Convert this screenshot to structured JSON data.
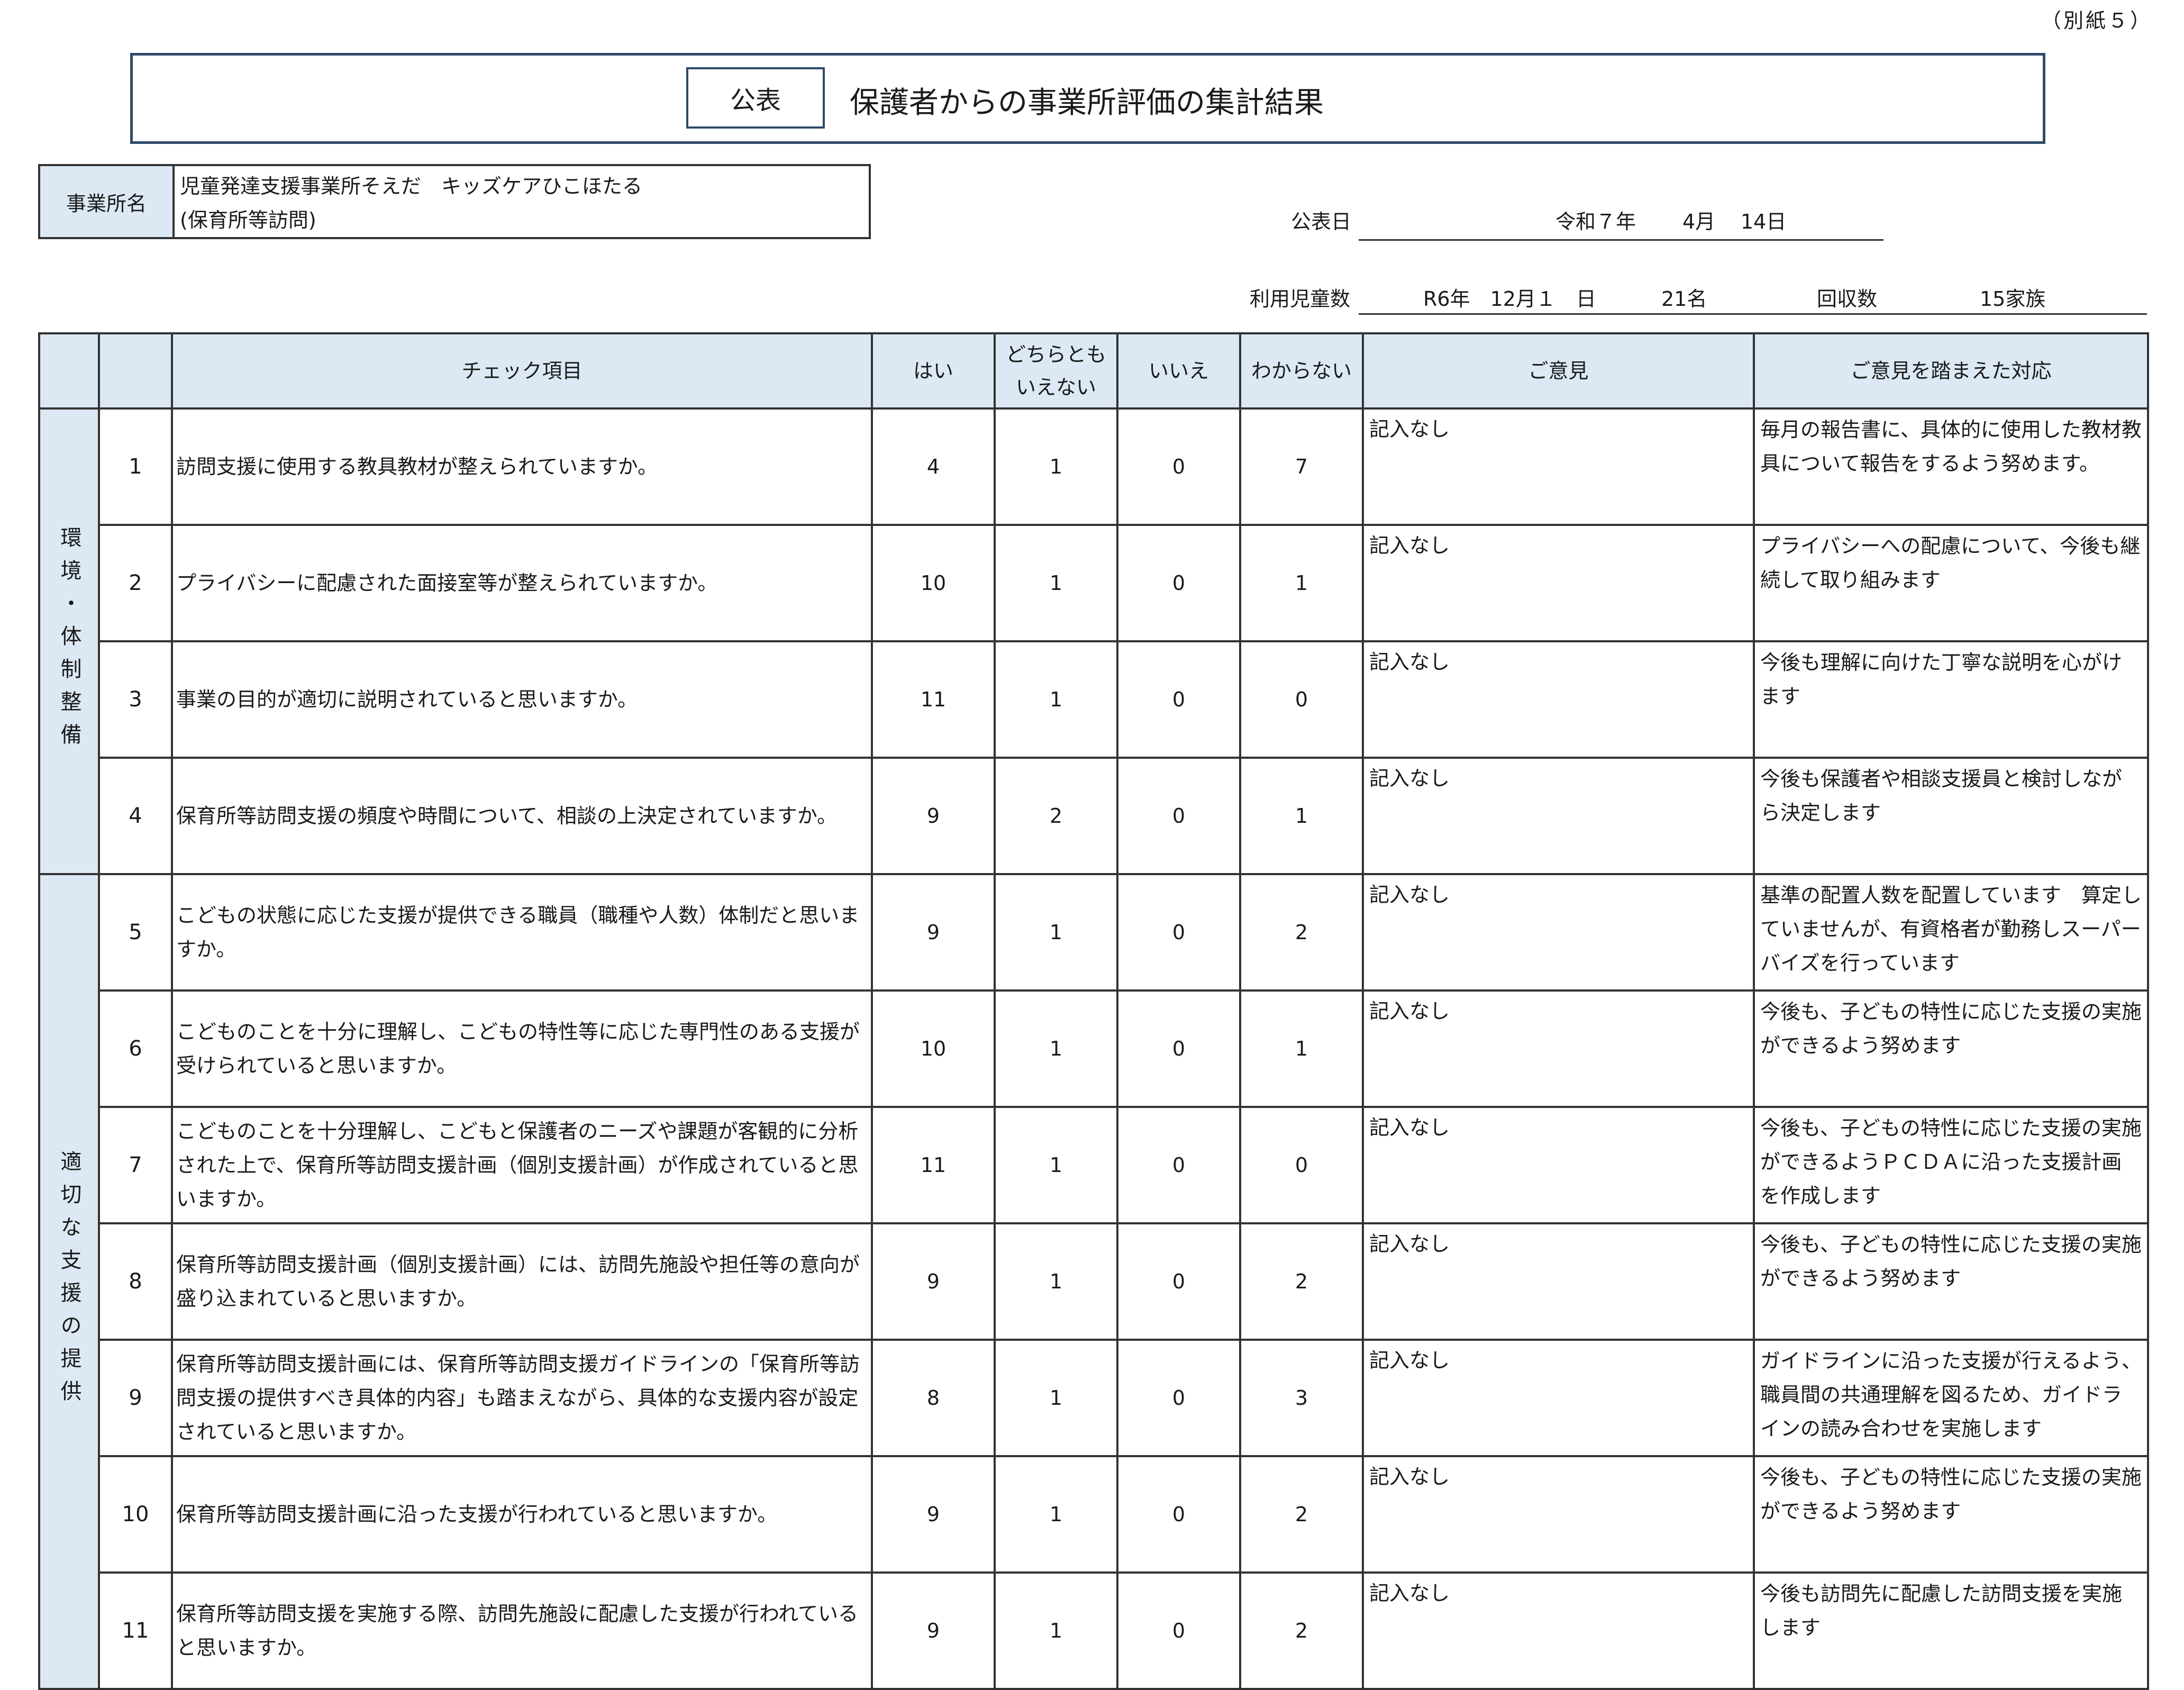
{
  "annex_label": "（別紙５）",
  "title": {
    "tag": "公表",
    "text": "保護者からの事業所評価の集計結果"
  },
  "business": {
    "label": "事業所名",
    "name_line1": "児童発達支援事業所そえだ　キッズケアひこほたる",
    "name_line2": "(保育所等訪問)"
  },
  "publication": {
    "label": "公表日",
    "era_year": "令和７年",
    "month": "4月",
    "day": "14日"
  },
  "users": {
    "label": "利用児童数",
    "date": "R6年　12月１　日",
    "count": "21名",
    "recovered_label": "回収数",
    "recovered_value": "15家族"
  },
  "table": {
    "headers": {
      "check": "チェック項目",
      "yes": "はい",
      "neither_1": "どちらとも",
      "neither_2": "いえない",
      "no": "いいえ",
      "unknown": "わからない",
      "opinion": "ご意見",
      "response": "ご意見を踏まえた対応"
    },
    "categories": [
      {
        "label": "環境・体制整備"
      },
      {
        "label": "適切な支援の提供"
      }
    ],
    "rows": [
      {
        "no": "1",
        "question": "訪問支援に使用する教具教材が整えられていますか。",
        "yes": "4",
        "neither": "1",
        "no_count": "0",
        "unknown": "7",
        "opinion": "記入なし",
        "response": "毎月の報告書に、具体的に使用した教材教具について報告をするよう努めます。"
      },
      {
        "no": "2",
        "question": "プライバシーに配慮された面接室等が整えられていますか。",
        "yes": "10",
        "neither": "1",
        "no_count": "0",
        "unknown": "1",
        "opinion": "記入なし",
        "response": "プライバシーへの配慮について、今後も継続して取り組みます"
      },
      {
        "no": "3",
        "question": "事業の目的が適切に説明されていると思いますか。",
        "yes": "11",
        "neither": "1",
        "no_count": "0",
        "unknown": "0",
        "opinion": "記入なし",
        "response": "今後も理解に向けた丁寧な説明を心がけます"
      },
      {
        "no": "4",
        "question": "保育所等訪問支援の頻度や時間について、相談の上決定されていますか。",
        "yes": "9",
        "neither": "2",
        "no_count": "0",
        "unknown": "1",
        "opinion": "記入なし",
        "response": "今後も保護者や相談支援員と検討しながら決定します"
      },
      {
        "no": "5",
        "question": "こどもの状態に応じた支援が提供できる職員（職種や人数）体制だと思いますか。",
        "yes": "9",
        "neither": "1",
        "no_count": "0",
        "unknown": "2",
        "opinion": "記入なし",
        "response": "基準の配置人数を配置しています　算定していませんが、有資格者が勤務しスーパーバイズを行っています"
      },
      {
        "no": "6",
        "question": "こどものことを十分に理解し、こどもの特性等に応じた専門性のある支援が受けられていると思いますか。",
        "yes": "10",
        "neither": "1",
        "no_count": "0",
        "unknown": "1",
        "opinion": "記入なし",
        "response": "今後も、子どもの特性に応じた支援の実施ができるよう努めます"
      },
      {
        "no": "7",
        "question": "こどものことを十分理解し、こどもと保護者のニーズや課題が客観的に分析された上で、保育所等訪問支援計画（個別支援計画）が作成されていると思いますか。",
        "yes": "11",
        "neither": "1",
        "no_count": "0",
        "unknown": "0",
        "opinion": "記入なし",
        "response": "今後も、子どもの特性に応じた支援の実施ができるようＰＣＤＡに沿った支援計画を作成します"
      },
      {
        "no": "8",
        "question": "保育所等訪問支援計画（個別支援計画）には、訪問先施設や担任等の意向が盛り込まれていると思いますか。",
        "yes": "9",
        "neither": "1",
        "no_count": "0",
        "unknown": "2",
        "opinion": "記入なし",
        "response": "今後も、子どもの特性に応じた支援の実施ができるよう努めます"
      },
      {
        "no": "9",
        "question": "保育所等訪問支援計画には、保育所等訪問支援ガイドラインの「保育所等訪問支援の提供すべき具体的内容」も踏まえながら、具体的な支援内容が設定されていると思いますか。",
        "yes": "8",
        "neither": "1",
        "no_count": "0",
        "unknown": "3",
        "opinion": "記入なし",
        "response": "ガイドラインに沿った支援が行えるよう、職員間の共通理解を図るため、ガイドラインの読み合わせを実施します"
      },
      {
        "no": "10",
        "question": "保育所等訪問支援計画に沿った支援が行われていると思いますか。",
        "yes": "9",
        "neither": "1",
        "no_count": "0",
        "unknown": "2",
        "opinion": "記入なし",
        "response": "今後も、子どもの特性に応じた支援の実施ができるよう努めます"
      },
      {
        "no": "11",
        "question": "保育所等訪問支援を実施する際、訪問先施設に配慮した支援が行われていると思いますか。",
        "yes": "9",
        "neither": "1",
        "no_count": "0",
        "unknown": "2",
        "opinion": "記入なし",
        "response": "今後も訪問先に配慮した訪問支援を実施します"
      }
    ]
  }
}
